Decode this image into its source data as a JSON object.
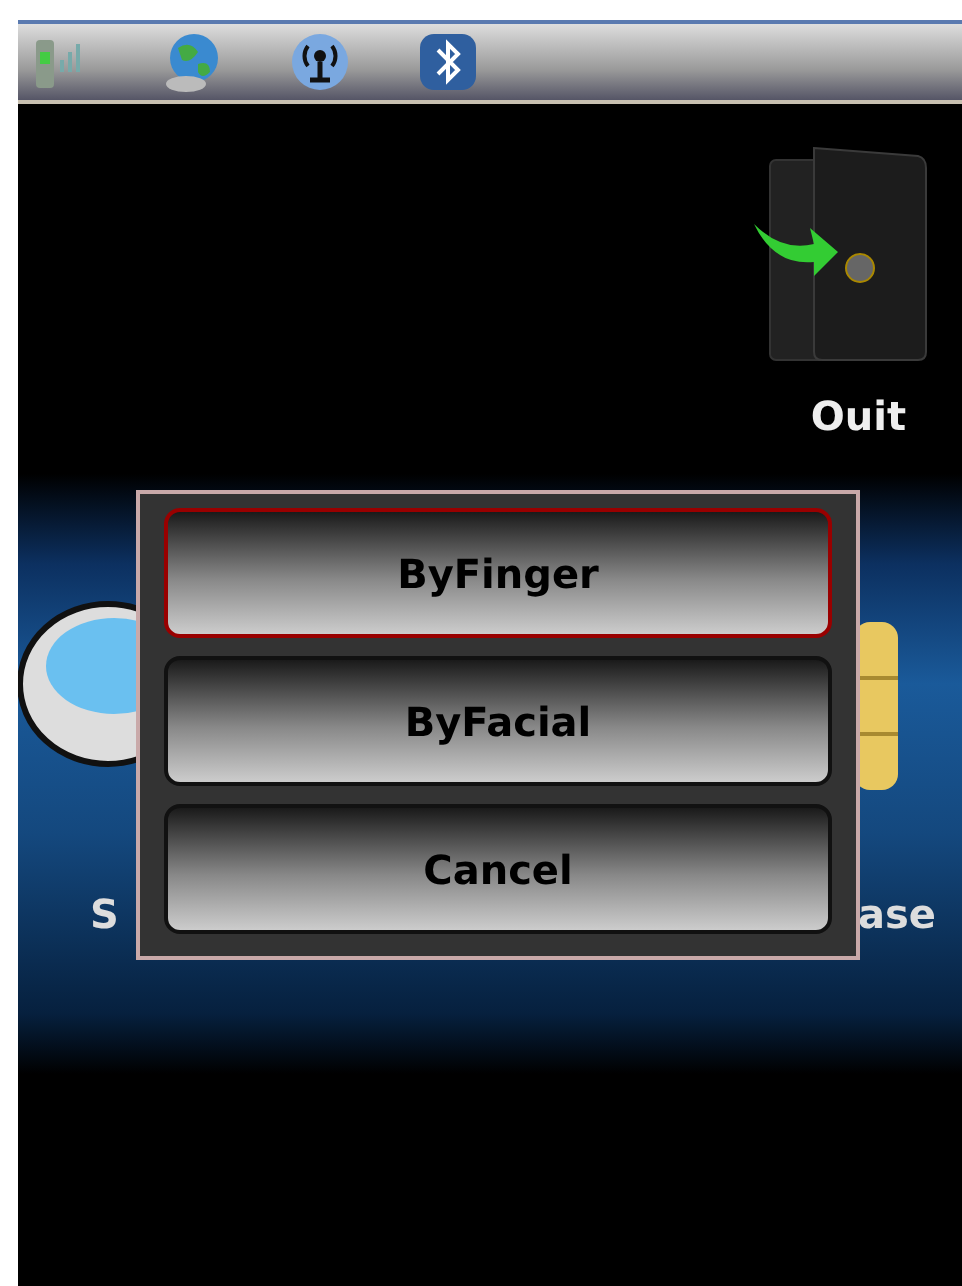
{
  "quit": {
    "label": "Ouit"
  },
  "menu": [
    {
      "label": "S"
    },
    {
      "label": "ase"
    }
  ],
  "dialog": {
    "options": [
      {
        "label": "ByFinger",
        "selected": true
      },
      {
        "label": "ByFacial",
        "selected": false
      },
      {
        "label": "Cancel",
        "selected": false
      }
    ]
  }
}
